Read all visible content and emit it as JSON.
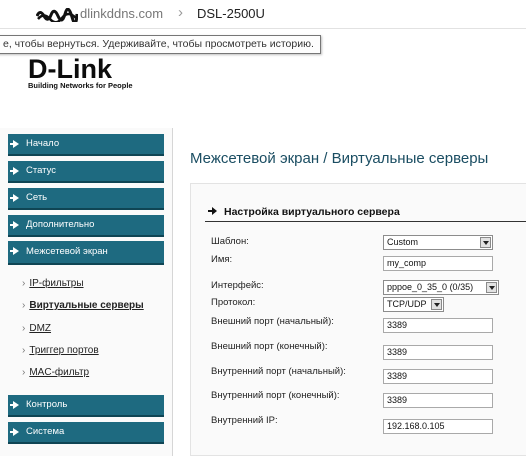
{
  "address_bar": {
    "host": "dlinkddns.com",
    "separator": "›",
    "page": "DSL-2500U"
  },
  "tooltip": "е, чтобы вернуться. Удерживайте, чтобы просмотреть историю.",
  "logo": {
    "brand": "D-Link",
    "tagline": "Building Networks for People"
  },
  "nav": {
    "items": [
      {
        "label": "Начало"
      },
      {
        "label": "Статус"
      },
      {
        "label": "Сеть"
      },
      {
        "label": "Дополнительно"
      },
      {
        "label": "Межсетевой экран"
      }
    ],
    "subitems": [
      {
        "label": "IP-фильтры"
      },
      {
        "label": "Виртуальные серверы"
      },
      {
        "label": "DMZ"
      },
      {
        "label": "Триггер портов"
      },
      {
        "label": "MAC-фильтр"
      }
    ],
    "bottom_items": [
      {
        "label": "Контроль"
      },
      {
        "label": "Система"
      }
    ]
  },
  "main": {
    "title": "Межсетевой экран /  Виртуальные серверы",
    "section_title": "Настройка виртуального сервера",
    "form": {
      "template_label": "Шаблон:",
      "template_value": "Custom",
      "name_label": "Имя:",
      "name_value": "my_comp",
      "interface_label": "Интерфейс:",
      "interface_value": "pppoe_0_35_0 (0/35)",
      "protocol_label": "Протокол:",
      "protocol_value": "TCP/UDP",
      "ext_port_start_label": "Внешний порт (начальный):",
      "ext_port_start_value": "3389",
      "ext_port_end_label": "Внешний порт (конечный):",
      "ext_port_end_value": "3389",
      "int_port_start_label": "Внутренний порт (начальный):",
      "int_port_start_value": "3389",
      "int_port_end_label": "Внутренний порт (конечный):",
      "int_port_end_value": "3389",
      "int_ip_label": "Внутренний IP:",
      "int_ip_value": "192.168.0.105"
    }
  },
  "colors": {
    "nav_bg": "#1e6a80",
    "title_color": "#1a4d62"
  }
}
